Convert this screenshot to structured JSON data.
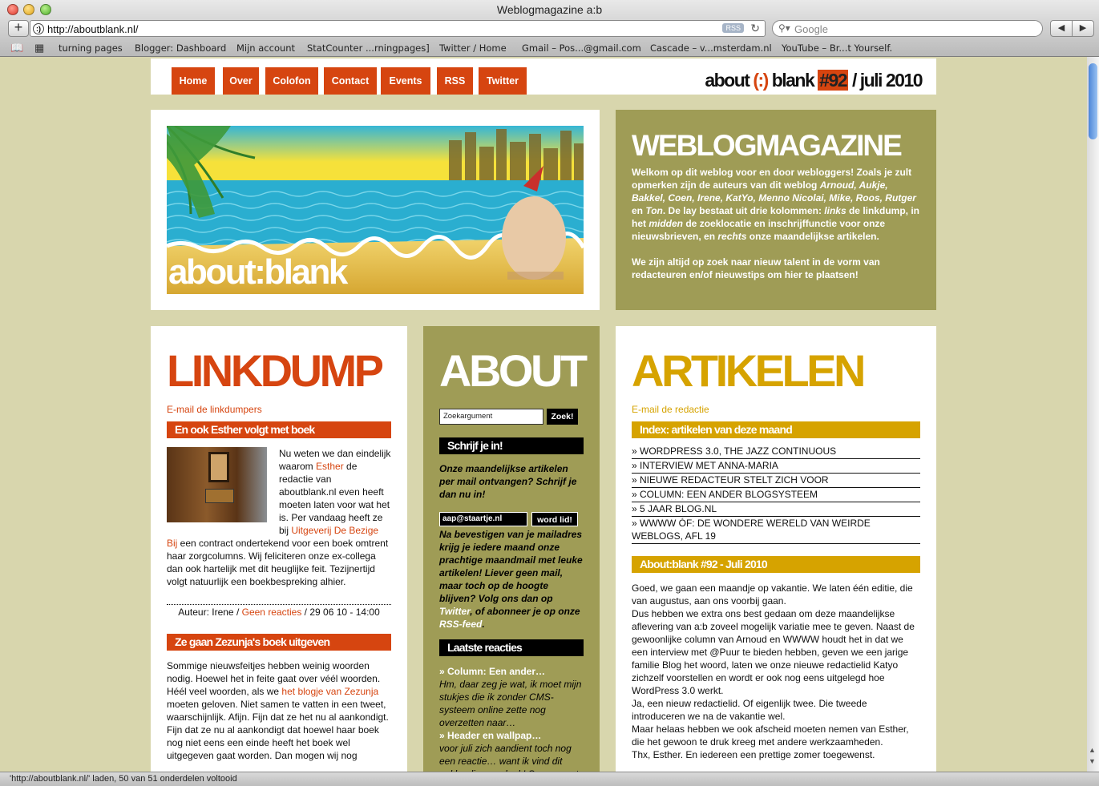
{
  "browser": {
    "window_title": "Weblogmagazine a:b",
    "url": "http://aboutblank.nl/",
    "rss_badge": "RSS",
    "search_placeholder": "Google",
    "bookmarks": [
      "turning pages",
      "Blogger: Dashboard",
      "Mijn account",
      "StatCounter ...rningpages]",
      "Twitter / Home",
      "Gmail – Pos...@gmail.com",
      "Cascade – v...msterdam.nl",
      "YouTube – Br...t Yourself."
    ],
    "status": "'http://aboutblank.nl/' laden, 50 van 51 onderdelen voltooid"
  },
  "nav": [
    "Home",
    "Over",
    "Colofon",
    "Contact",
    "Events",
    "RSS",
    "Twitter"
  ],
  "brand": {
    "about": "about",
    "smile": "(:)",
    "blank": "blank",
    "issue": "#92",
    "date": "/ juli 2010"
  },
  "hero": {
    "wordmark": "about:blank"
  },
  "intro": {
    "title": "WEBLOGMAGAZINE",
    "p1_a": "Welkom op dit weblog voor en door webloggers! Zoals je zult opmerken zijn de auteurs van dit weblog ",
    "authors": "Arnoud, Aukje, Bakkel, Coen, Irene, KatYo, Menno Nicolai, Mike, Roos, Rutger",
    "en": " en ",
    "ton": "Ton",
    "p1_b": ". De lay bestaat uit drie kolommen: ",
    "links": "links",
    "p1_c": " de linkdump, in het ",
    "midden": "midden",
    "p1_d": " de zoeklocatie en inschrijffunctie voor onze nieuwsbrieven, en ",
    "rechts": "rechts",
    "p1_e": " onze maandelijkse artikelen.",
    "p2": "We zijn altijd op zoek naar nieuw talent in de vorm van redacteuren en/of nieuwstips om hier te plaatsen!"
  },
  "linkdump": {
    "title": "LINKDUMP",
    "email": "E-mail de linkdumpers",
    "post1": {
      "title": "En ook Esther volgt met boek",
      "t1": "Nu weten we dan eindelijk waarom ",
      "l1": "Esther",
      "t2": " de redactie van aboutblank.nl even heeft moeten laten voor wat het is. Per vandaag heeft ze bij ",
      "l2": "Uitgeverij De Bezige Bij",
      "t3": " een contract ondertekend voor een boek omtrent haar zorgcolumns. Wij feliciteren onze ex-collega dan ook hartelijk met dit heuglijke feit. Tezijnertijd volgt natuurlijk een boekbespreking alhier.",
      "meta_a": "Auteur: Irene / ",
      "meta_link": "Geen reacties",
      "meta_b": " / 29 06 10 - 14:00"
    },
    "post2": {
      "title": "Ze gaan Zezunja's boek uitgeven",
      "t1": "Sommige nieuwsfeitjes hebben weinig woorden nodig. Hoewel het in feite gaat over véél woorden. Héél veel woorden, als we ",
      "l1": "het blogje van Zezunja",
      "t2": " moeten geloven. Niet samen te vatten in een tweet, waarschijnlijk. Afijn. Fijn dat ze het nu al aankondigt. Fijn dat ze nu al aankondigt dat hoewel haar boek nog niet eens een einde heeft het boek wel uitgegeven gaat worden. Dan mogen wij nog"
    }
  },
  "about": {
    "title": "ABOUT",
    "search_placeholder": "Zoekargument",
    "search_button": "Zoek!",
    "subscribe_title": "Schrijf je in!",
    "subscribe_text": "Onze maandelijkse artikelen per mail ontvangen? Schrijf je dan nu in!",
    "email_value": "aap@staartje.nl",
    "subscribe_button": "word lid!",
    "confirm_a": "Na bevestigen van je mailadres krijg je iedere maand onze prachtige maandmail met leuke artikelen! Liever geen mail, maar toch op de hoogte blijven? Volg ons dan op ",
    "twitter": "Twitter",
    "confirm_b": ", of abonneer je op onze ",
    "rss": "RSS-feed",
    "confirm_c": ".",
    "comments_title": "Laatste reacties",
    "c1_title": "» Column: Een ander…",
    "c1_text": "Hm, daar zeg je wat, ik moet mijn stukjes die ik zonder CMS-systeem online zette nog overzetten naar…",
    "c2_title": "» Header en wallpap…",
    "c2_text": "voor juli zich aandient toch nog een reactie… want ik vind dit gekke ding erg leuk! Succes met"
  },
  "artikelen": {
    "title": "ARTIKELEN",
    "email": "E-mail de redactie",
    "index_title": "Index: artikelen van deze maand",
    "index": [
      "» WORDPRESS 3.0, THE JAZZ CONTINUOUS",
      "» INTERVIEW MET ANNA-MARIA",
      "» NIEUWE REDACTEUR STELT ZICH VOOR",
      "» COLUMN: EEN ANDER BLOGSYSTEEM",
      "» 5 JAAR BLOG.NL",
      "» WWWW ÓF: DE WONDERE WERELD VAN WEIRDE WEBLOGS, AFL 19"
    ],
    "issue_title": "About:blank #92 - Juli 2010",
    "issue_text": "Goed, we gaan een maandje op vakantie. We laten één editie, die van augustus, aan ons voorbij gaan.\nDus hebben we extra ons best gedaan om deze maandelijkse aflevering van a:b zoveel mogelijk variatie mee te geven. Naast de gewoonlijke column van Arnoud en WWWW houdt het in dat we een interview met @Puur te bieden hebben, geven we een jarige familie Blog het woord, laten we onze nieuwe redactielid Katyo zichzelf voorstellen en wordt er ook nog eens uitgelegd hoe WordPress 3.0 werkt.\nJa, een nieuw redactielid. Of eigenlijk twee. Die tweede introduceren we na de vakantie wel.\nMaar helaas hebben we ook afscheid moeten nemen van Esther, die het gewoon te druk kreeg met andere werkzaamheden.\nThx, Esther. En iedereen een prettige zomer toegewenst."
  },
  "colors": {
    "orange": "#d64510",
    "olive": "#9f9c56",
    "gold": "#d6a300",
    "page_bg": "#d8d6ad"
  }
}
